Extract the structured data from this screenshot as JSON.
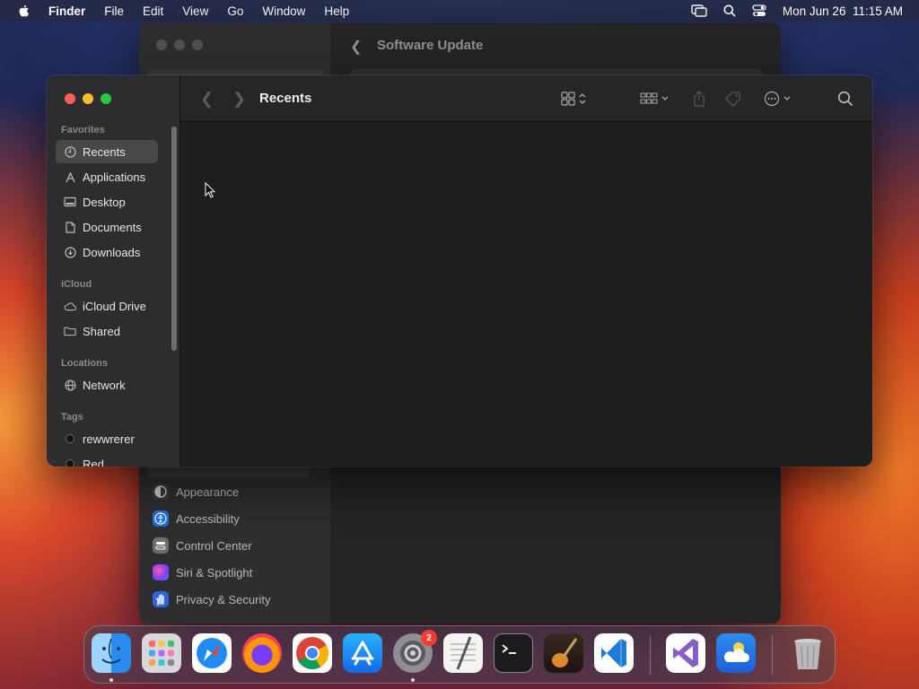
{
  "menubar": {
    "app_name": "Finder",
    "items": [
      "File",
      "Edit",
      "View",
      "Go",
      "Window",
      "Help"
    ],
    "clock": "Mon Jun 26  11:15 AM",
    "right_icons": [
      "screen-mirroring-icon",
      "spotlight-search-icon",
      "control-center-icon"
    ]
  },
  "settings_window": {
    "title": "Software Update",
    "sidebar_items": [
      {
        "label": "Appearance",
        "icon": "appearance-icon",
        "color": "#3a3a3c"
      },
      {
        "label": "Accessibility",
        "icon": "accessibility-icon",
        "color": "#1f6fe0"
      },
      {
        "label": "Control Center",
        "icon": "control-center-icon",
        "color": "#6d6d72"
      },
      {
        "label": "Siri & Spotlight",
        "icon": "siri-icon",
        "color": "#b23cd0"
      },
      {
        "label": "Privacy & Security",
        "icon": "privacy-hand-icon",
        "color": "#2f64d8"
      }
    ]
  },
  "finder": {
    "title": "Recents",
    "sections": {
      "favorites": "Favorites",
      "icloud": "iCloud",
      "locations": "Locations",
      "tags": "Tags"
    },
    "favorites": [
      "Recents",
      "Applications",
      "Desktop",
      "Documents",
      "Downloads"
    ],
    "icloud": [
      "iCloud Drive",
      "Shared"
    ],
    "locations": [
      "Network"
    ],
    "tags": [
      "rewwrerer",
      "Red"
    ],
    "selected": "Recents"
  },
  "dock": {
    "apps": [
      "Finder",
      "Launchpad",
      "Safari",
      "Firefox",
      "Chrome",
      "App Store",
      "System Settings",
      "TextEdit",
      "Terminal",
      "GarageBand",
      "Visual Studio Code",
      "Visual Studio",
      "Weather",
      "Trash"
    ],
    "system_settings_badge": "2"
  }
}
